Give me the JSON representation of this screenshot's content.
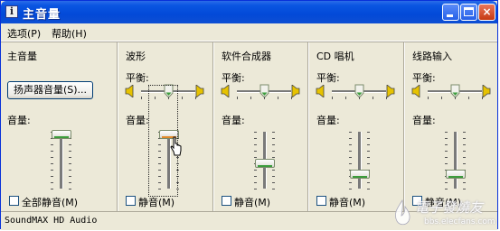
{
  "window": {
    "title": "主音量",
    "icon": "info-icon"
  },
  "caption_buttons": {
    "minimize": "minimize",
    "maximize": "maximize",
    "close": "×"
  },
  "menu": {
    "items": [
      "选项(P)",
      "帮助(H)"
    ]
  },
  "master": {
    "title": "主音量",
    "speaker_button": "扬声器音量(S)...",
    "volume_label": "音量:",
    "volume_level": 0.95,
    "mute_label": "全部静音(M)",
    "muted": false
  },
  "channels": [
    {
      "title": "波形",
      "balance_label": "平衡:",
      "volume_label": "音量:",
      "mute_label": "静音(M)",
      "balance": 0.5,
      "volume_level": 0.95,
      "muted": false,
      "focused": true
    },
    {
      "title": "软件合成器",
      "balance_label": "平衡:",
      "volume_label": "音量:",
      "mute_label": "静音(M)",
      "balance": 0.5,
      "volume_level": 0.45,
      "muted": false,
      "focused": false
    },
    {
      "title": "CD 唱机",
      "balance_label": "平衡:",
      "volume_label": "音量:",
      "mute_label": "静音(M)",
      "balance": 0.5,
      "volume_level": 0.25,
      "muted": false,
      "focused": false
    },
    {
      "title": "线路输入",
      "balance_label": "平衡:",
      "volume_label": "音量:",
      "mute_label": "静音(M)",
      "balance": 0.5,
      "volume_level": 0.25,
      "muted": false,
      "focused": false
    }
  ],
  "status": {
    "text": "SoundMAX HD Audio"
  },
  "watermark": {
    "cn": "電子發燒友",
    "url": "bbs.elecfans.com"
  },
  "colors": {
    "titlebar": "#0249d8",
    "face": "#ece9d8",
    "thumb_stripe": "#3c9c3c",
    "speaker": "#e6c200"
  }
}
